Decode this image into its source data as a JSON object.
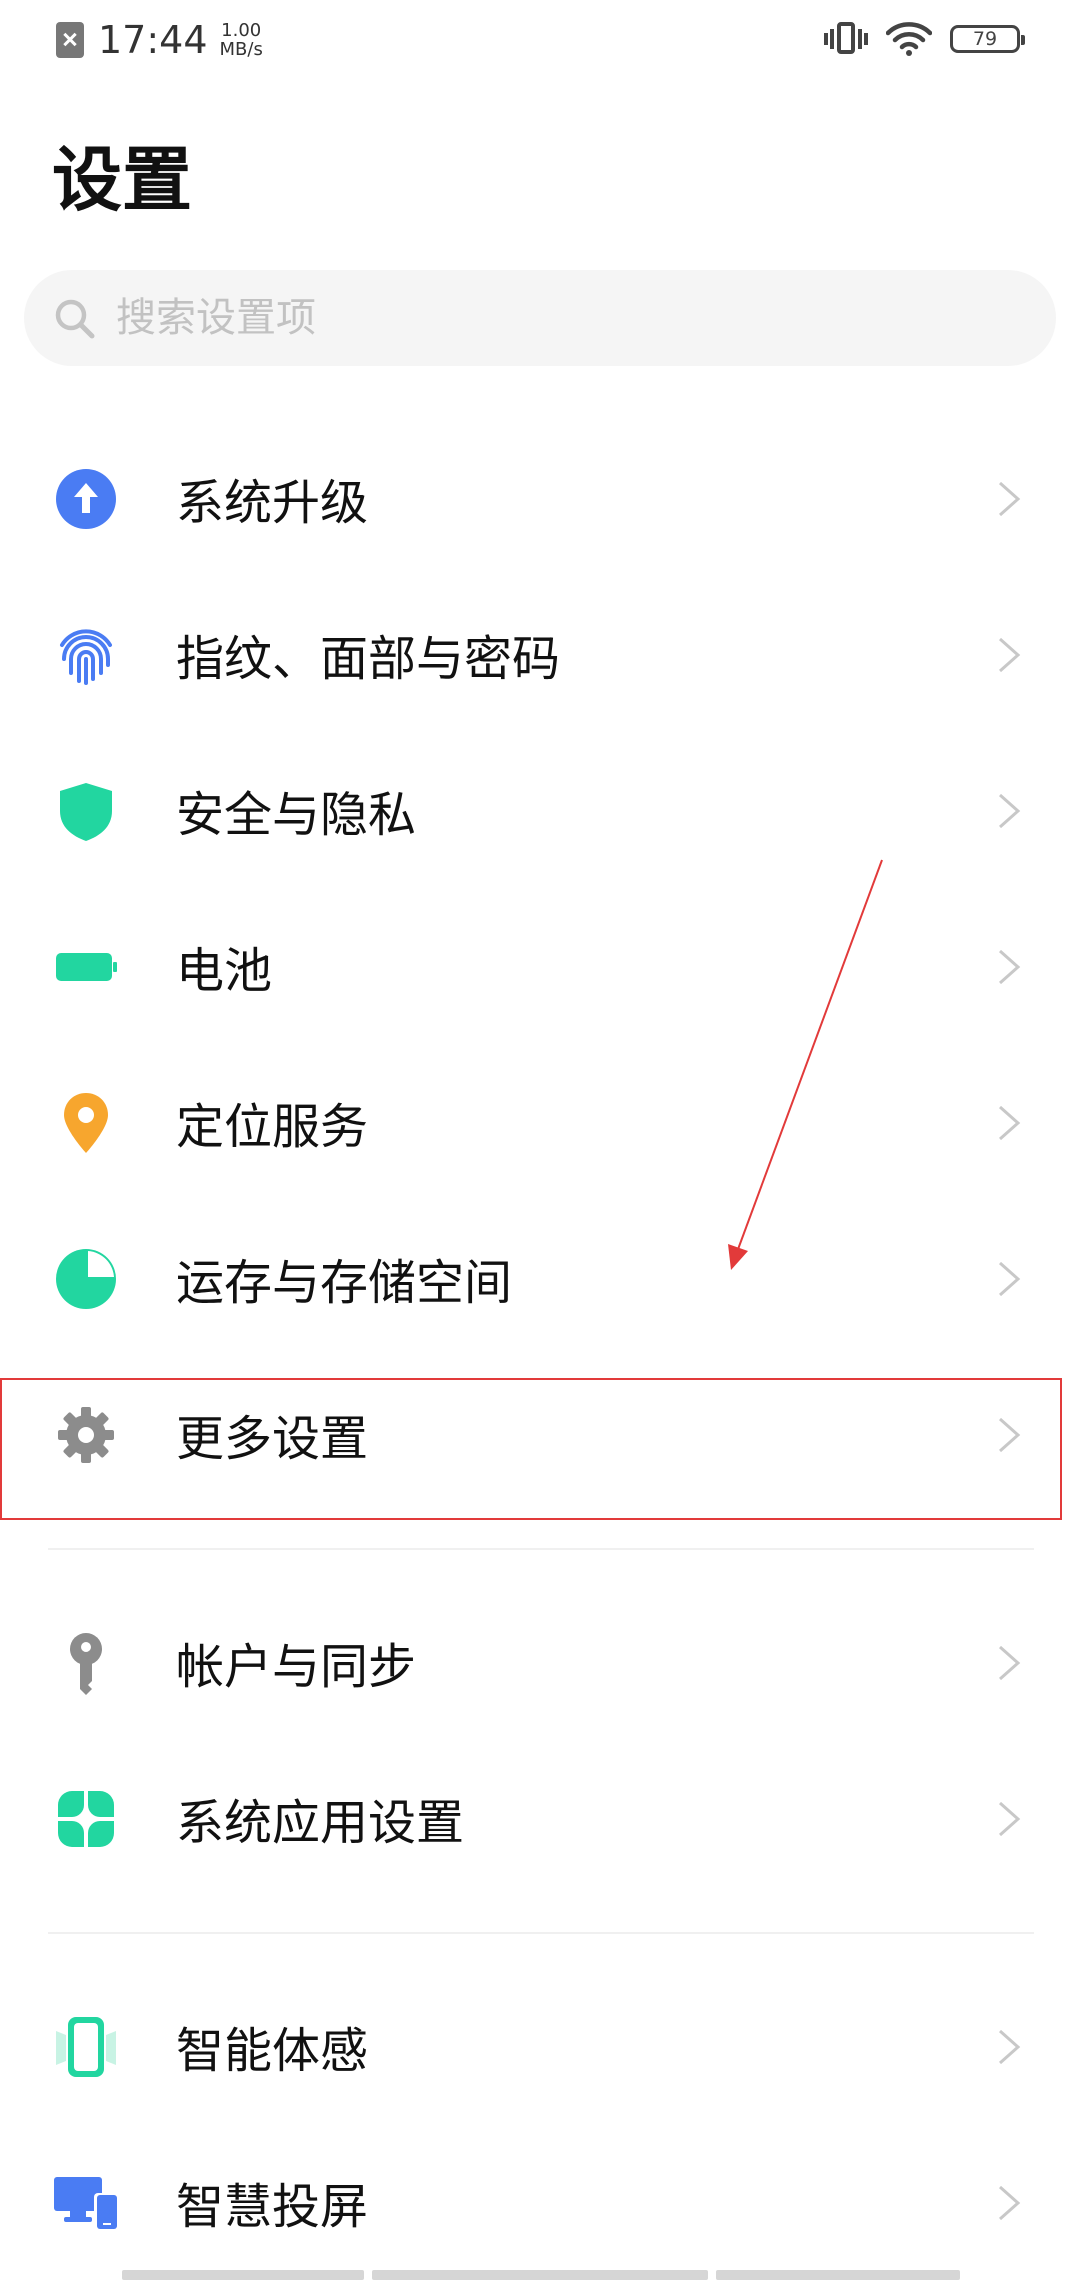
{
  "status_bar": {
    "time": "17:44",
    "speed_value": "1.00",
    "speed_unit": "MB/s",
    "battery_level": "79",
    "icons": [
      "no-sim-icon",
      "vibrate-icon",
      "wifi-icon",
      "battery-icon"
    ]
  },
  "page": {
    "title": "设置"
  },
  "search": {
    "placeholder": "搜索设置项"
  },
  "colors": {
    "blue": "#4a7cf3",
    "teal": "#22d6a0",
    "orange": "#f7a62e",
    "gray": "#8c8c8c",
    "annotation": "#e23a3a"
  },
  "items": [
    {
      "label": "系统升级",
      "icon": "system-update-icon"
    },
    {
      "label": "指纹、面部与密码",
      "icon": "fingerprint-icon"
    },
    {
      "label": "安全与隐私",
      "icon": "shield-icon"
    },
    {
      "label": "电池",
      "icon": "battery-icon"
    },
    {
      "label": "定位服务",
      "icon": "location-pin-icon"
    },
    {
      "label": "运存与存储空间",
      "icon": "storage-pie-icon"
    },
    {
      "label": "更多设置",
      "icon": "gear-icon"
    },
    {
      "label": "帐户与同步",
      "icon": "key-icon"
    },
    {
      "label": "系统应用设置",
      "icon": "apps-clover-icon"
    },
    {
      "label": "智能体感",
      "icon": "smart-motion-icon"
    },
    {
      "label": "智慧投屏",
      "icon": "screen-cast-icon"
    }
  ]
}
